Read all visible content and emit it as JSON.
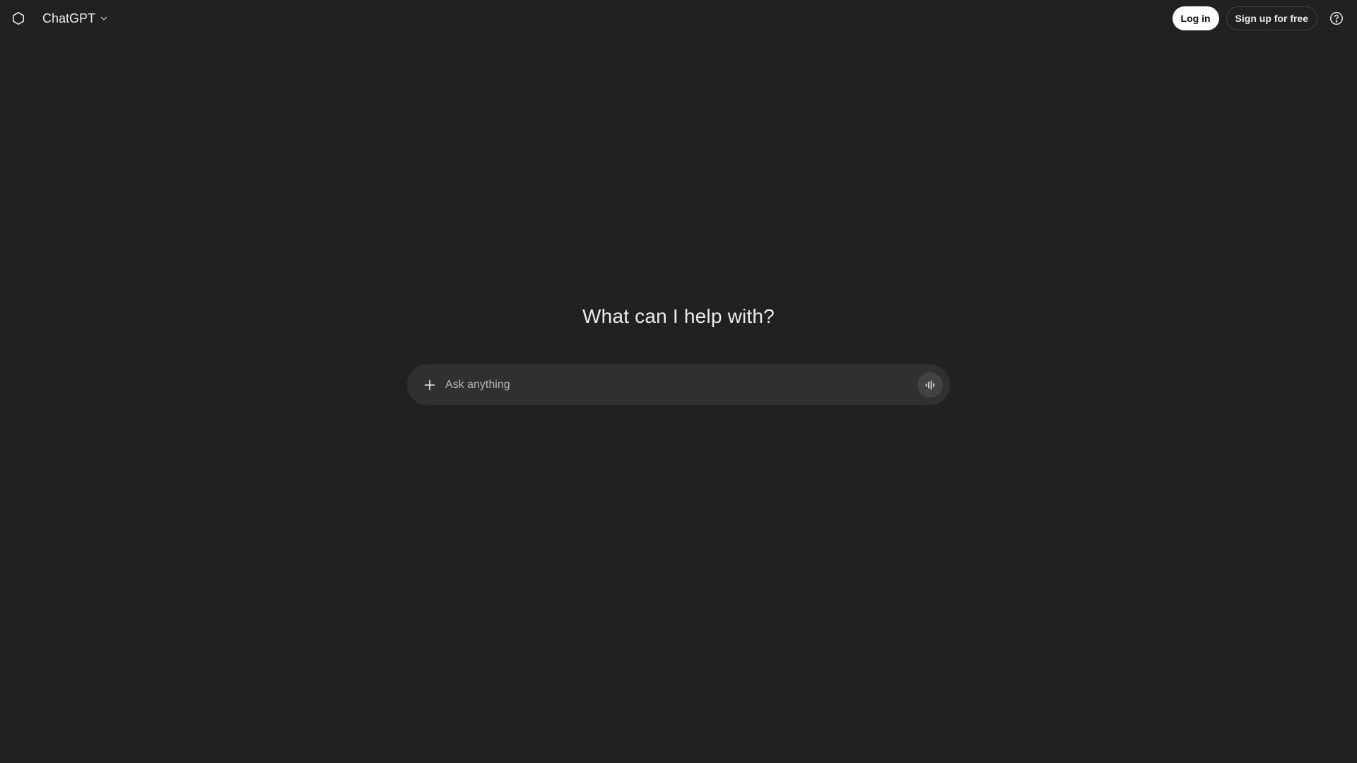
{
  "header": {
    "logo_icon": "openai-logo-icon",
    "model_name": "ChatGPT",
    "model_chevron_icon": "chevron-down-icon",
    "login_label": "Log in",
    "signup_label": "Sign up for free",
    "help_icon": "help-circle-icon"
  },
  "main": {
    "headline": "What can I help with?",
    "composer": {
      "attach_icon": "plus-icon",
      "placeholder": "Ask anything",
      "value": "",
      "voice_icon": "voice-waveform-icon"
    }
  },
  "colors": {
    "background": "#212121",
    "composer_bg": "#303030",
    "voice_button_bg": "#424242",
    "text": "#ececec",
    "login_bg": "#ffffff",
    "login_text": "#0d0d0d"
  }
}
